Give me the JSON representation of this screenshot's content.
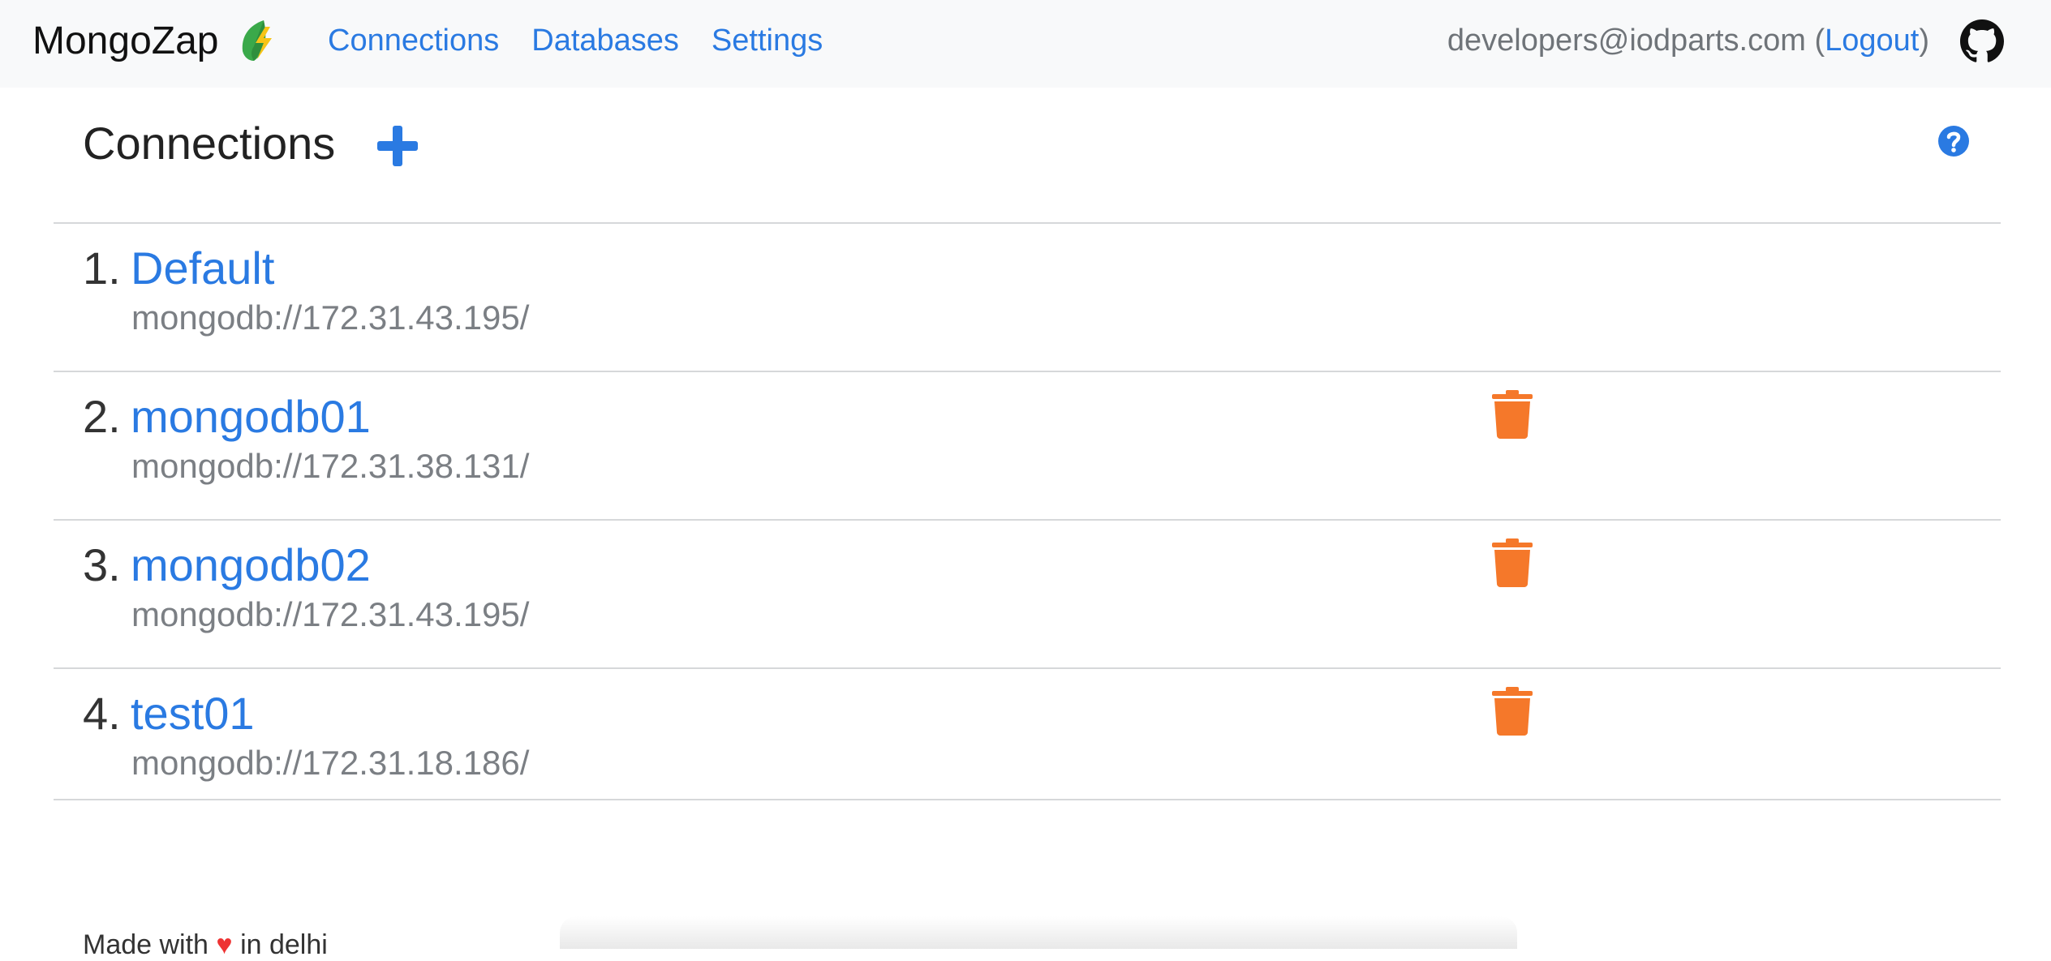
{
  "navbar": {
    "brand": "MongoZap",
    "links": [
      "Connections",
      "Databases",
      "Settings"
    ],
    "user_email": "developers@iodparts.com",
    "paren_open": " (",
    "logout_label": "Logout",
    "paren_close": ")",
    "github_icon": "github-icon"
  },
  "page": {
    "title": "Connections",
    "add_icon": "plus-icon",
    "help_icon": "question-circle-icon"
  },
  "connections": [
    {
      "number": "1.",
      "name": "Default",
      "url": "mongodb://172.31.43.195/",
      "deletable": false
    },
    {
      "number": "2.",
      "name": "mongodb01",
      "url": "mongodb://172.31.38.131/",
      "deletable": true
    },
    {
      "number": "3.",
      "name": "mongodb02",
      "url": "mongodb://172.31.43.195/",
      "deletable": true
    },
    {
      "number": "4.",
      "name": "test01",
      "url": "mongodb://172.31.18.186/",
      "deletable": true
    }
  ],
  "footer": {
    "made_with": "Made with",
    "heart": "♥",
    "in": "in delhi"
  },
  "colors": {
    "link": "#2a7ae2",
    "trash": "#f5782a",
    "navbar_bg": "#f8f9fa"
  }
}
